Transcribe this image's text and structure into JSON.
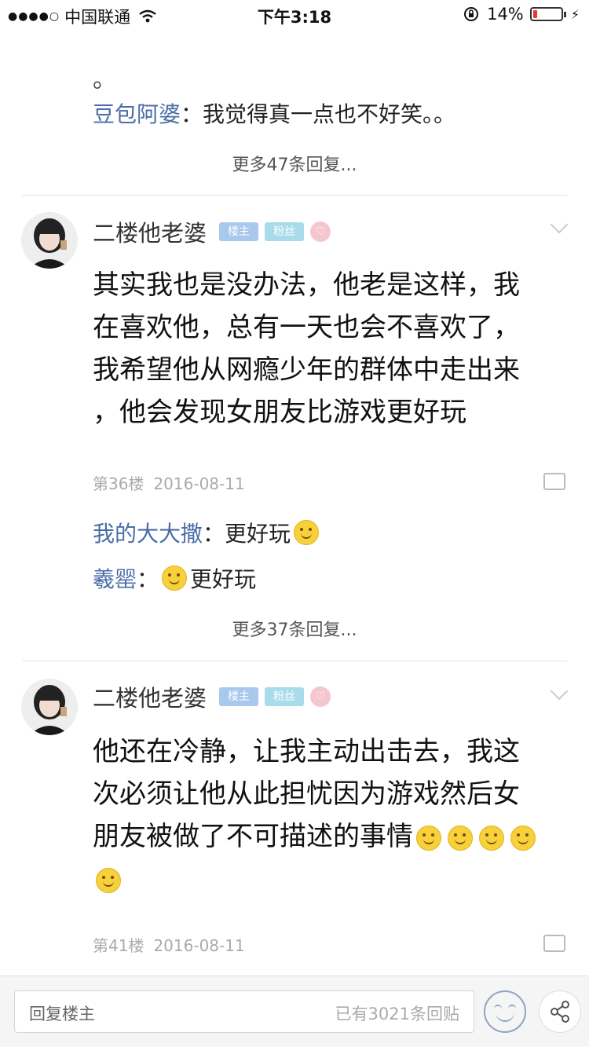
{
  "status_bar": {
    "signal": "●●●●○",
    "carrier": "中国联通",
    "time": "下午3:18",
    "battery_percent": "14%",
    "battery_level": 0.14,
    "battery_color": "#e53935"
  },
  "thread": {
    "previous_post": {
      "tail_char": "。",
      "sub_reply": {
        "user": "豆包阿婆",
        "separator": "：",
        "text": "我觉得真一点也不好笑。。"
      },
      "more_replies": "更多47条回复..."
    },
    "posts": [
      {
        "author": "二楼他老婆",
        "badge_host": "楼主",
        "badge_fan": "粉丝",
        "level_icon": "heart-level-icon",
        "body_lines": [
          "其实我也是没办法，他老是这样，我",
          "在喜欢他，总有一天也会不喜欢了，",
          "我希望他从网瘾少年的群体中走出来",
          "，他会发现女朋友比游戏更好玩"
        ],
        "floor": "第36楼",
        "date": "2016-08-11",
        "sub_replies": [
          {
            "user": "我的大大撒",
            "separator": "：",
            "text": "更好玩",
            "emoji_after": true
          },
          {
            "user": "羲罂",
            "separator": "：",
            "text": "更好玩",
            "emoji_before": true
          }
        ],
        "more_replies": "更多37条回复..."
      },
      {
        "author": "二楼他老婆",
        "badge_host": "楼主",
        "badge_fan": "粉丝",
        "level_icon": "heart-level-icon",
        "body_lines": [
          "他还在冷静，让我主动出击去，我这",
          "次必须让他从此担忧因为游戏然后女",
          "朋友被做了不可描述的事情"
        ],
        "emoji_count_line3": 4,
        "emoji_count_line4": 1,
        "floor": "第41楼",
        "date": "2016-08-11"
      }
    ]
  },
  "bottom_bar": {
    "reply_placeholder": "回复楼主",
    "reply_count": "已有3021条回贴",
    "emoji_icon": "smile-face-icon",
    "share_icon": "share-icon"
  }
}
